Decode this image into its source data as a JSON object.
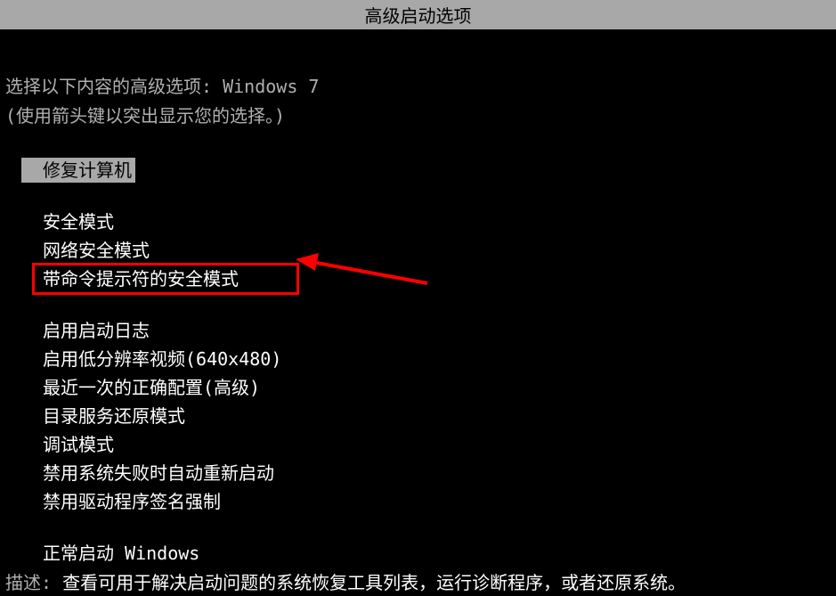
{
  "title": "高级启动选项",
  "intro": {
    "prefix": "选择以下内容的高级选项: ",
    "os": "Windows 7"
  },
  "hint": "(使用箭头键以突出显示您的选择。)",
  "menu": {
    "repair": "修复计算机",
    "safe_mode": "安全模式",
    "safe_mode_network": "网络安全模式",
    "safe_mode_cmd": "带命令提示符的安全模式",
    "boot_log": "启用启动日志",
    "low_res": "启用低分辨率视频(640x480)",
    "last_known": "最近一次的正确配置(高级)",
    "ds_restore": "目录服务还原模式",
    "debug": "调试模式",
    "disable_auto_restart": "禁用系统失败时自动重新启动",
    "disable_driver_sig": "禁用驱动程序签名强制",
    "normal": "正常启动 Windows"
  },
  "description": {
    "label": "描述: ",
    "text": "查看可用于解决启动问题的系统恢复工具列表，运行诊断程序，或者还原系统。"
  }
}
